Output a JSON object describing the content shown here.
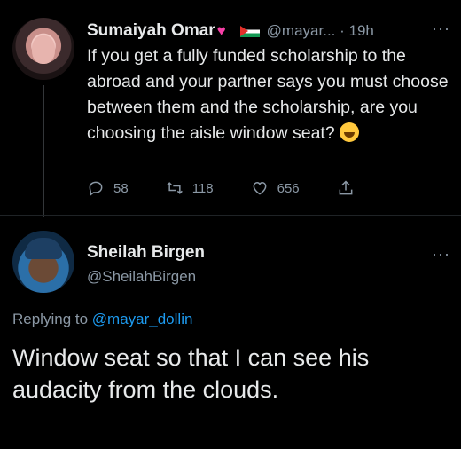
{
  "tweet": {
    "author_name": "Sumaiyah Omar",
    "handle_time": "@mayar... · 19h",
    "more": "···",
    "text": "If you get a fully funded scholarship to the abroad and your partner says you must choose between them and the scholarship, are you choosing the aisle window seat?",
    "stats": {
      "replies": "58",
      "retweets": "118",
      "likes": "656"
    },
    "icons": [
      "heart-emoji-icon",
      "flag-icon",
      "laughing-emoji-icon",
      "reply-icon",
      "retweet-icon",
      "like-icon",
      "share-icon"
    ]
  },
  "reply": {
    "author_name": "Sheilah Birgen",
    "handle": "@SheilahBirgen",
    "more": "···",
    "replying_prefix": "Replying to ",
    "replying_to": "@mayar_dollin",
    "text": "Window seat so that I can see his audacity from the clouds."
  },
  "colors": {
    "background": "#000000",
    "text": "#e7e9ea",
    "secondary": "#8b98a5",
    "link": "#1d9bf0"
  }
}
